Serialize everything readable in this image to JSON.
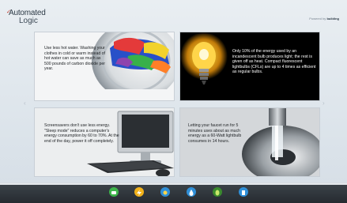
{
  "header": {
    "logo_line1": "Automated",
    "logo_line2": "Logic",
    "powered_prefix": "Powered by",
    "powered_brand": "building"
  },
  "cards": [
    {
      "text": "Use less hot water. Washing your clothes in cold or warm instead of hot water can save as much as 500 pounds of carbon dioxide per year."
    },
    {
      "text": "Only 10% of the energy used by an incandescent bulb produces light; the rest is given off as heat. Compact fluorescent lightbulbs (CFLs) are up to 4 times as efficient as regular bulbs."
    },
    {
      "text": "Screensavers don't use less energy. \"Sleep mode\" reduces a computer's energy consumption by 60 to 70%. At the end of the day, power it off completely."
    },
    {
      "text": "Letting your faucet run for 5 minutes uses about as much energy as a 60-Watt lightbulb consumes in 14 hours."
    }
  ],
  "dock": {
    "items": [
      {
        "icon": "overview-icon",
        "color": "#3cb44a"
      },
      {
        "icon": "energy-icon",
        "color": "#f2b21b"
      },
      {
        "icon": "solar-icon",
        "color": "#2f8fd8"
      },
      {
        "icon": "water-icon",
        "color": "#2f8fd8"
      },
      {
        "icon": "leaf-icon",
        "color": "#3a8a2e"
      },
      {
        "icon": "building-icon",
        "color": "#2f8fd8"
      }
    ]
  }
}
